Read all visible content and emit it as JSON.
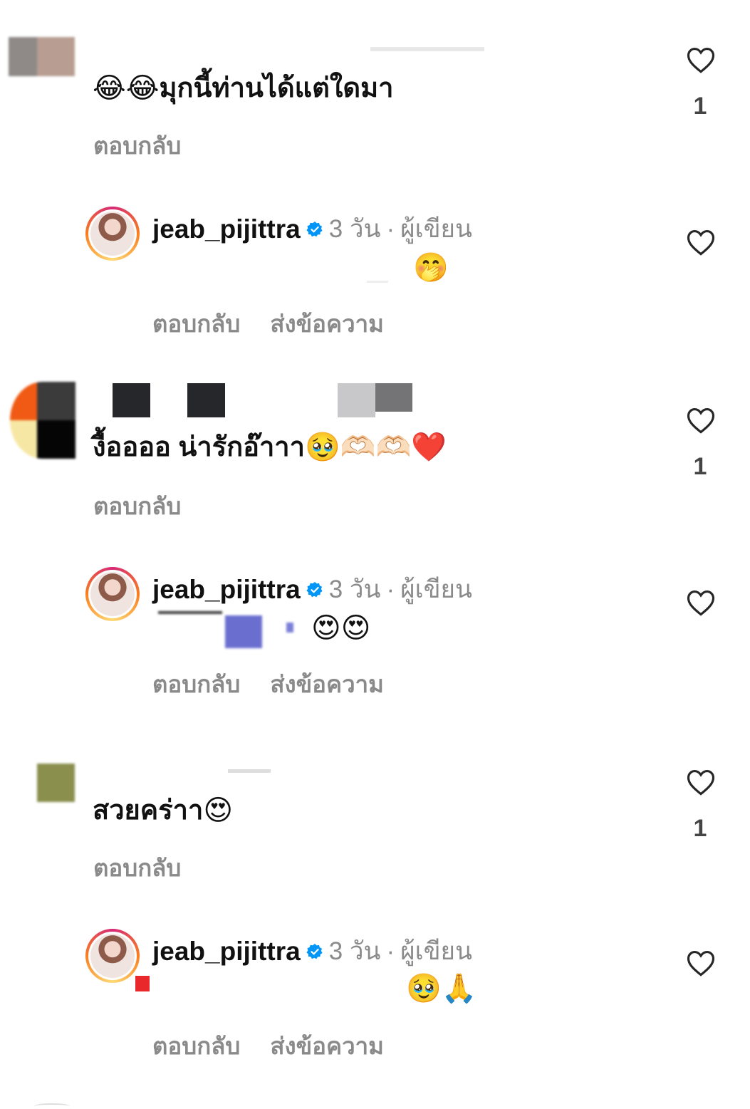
{
  "comments": [
    {
      "text": "มุกนี้ท่านได้แต่ใดมา",
      "emoji_prefix": "😂😂",
      "reply_label": "ตอบกลับ",
      "like_count": "1",
      "author_reply": {
        "username": "jeab_pijittra",
        "time": "3 วัน",
        "separator": "·",
        "role": "ผู้เขียน",
        "emoji": "🤭",
        "reply_label": "ตอบกลับ",
        "message_label": "ส่งข้อความ"
      }
    },
    {
      "text": "งื้ออออ น่ารักอ๊าาา",
      "emoji_suffix": "🥹🫶🏻🫶🏻❤️",
      "reply_label": "ตอบกลับ",
      "like_count": "1",
      "author_reply": {
        "username": "jeab_pijittra",
        "time": "3 วัน",
        "separator": "·",
        "role": "ผู้เขียน",
        "emoji": "😍😍",
        "reply_label": "ตอบกลับ",
        "message_label": "ส่งข้อความ"
      }
    },
    {
      "text": "สวยคร่าา",
      "emoji_suffix": "😍",
      "reply_label": "ตอบกลับ",
      "like_count": "1",
      "author_reply": {
        "username": "jeab_pijittra",
        "time": "3 วัน",
        "separator": "·",
        "role": "ผู้เขียน",
        "emoji": "🥹🙏",
        "reply_label": "ตอบกลับ",
        "message_label": "ส่งข้อความ"
      }
    }
  ],
  "icons": {
    "heart": "heart-outline-icon",
    "verified": "verified-badge-icon"
  },
  "colors": {
    "verified_blue": "#0095f6",
    "secondary_text": "#8a8a8a",
    "heart_stroke": "#262626"
  }
}
